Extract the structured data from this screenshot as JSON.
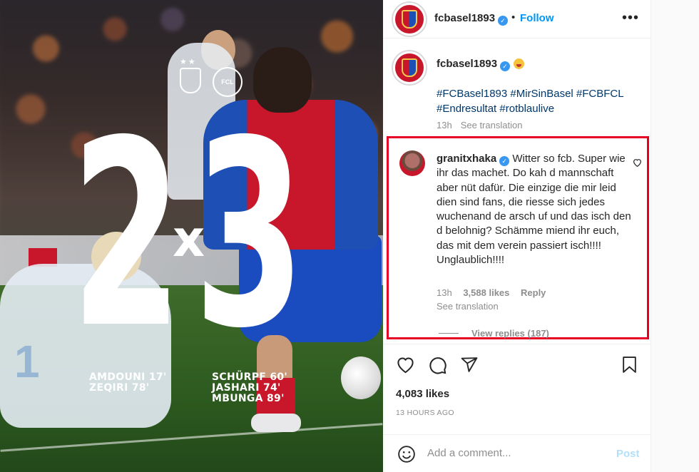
{
  "post_image": {
    "score_home": "2",
    "score_separator": "x",
    "score_away": "3",
    "scorers_home": [
      "AMDOUNI 17'",
      "ZEQIRI 78'"
    ],
    "scorers_away": [
      "SCHÜRPF 60'",
      "JASHARI 74'",
      "MBUNGA 89'"
    ],
    "crest_right_text": "FCL",
    "crest_left_stars": "★★",
    "player_number": "1"
  },
  "header": {
    "username": "fcbasel1893",
    "separator": "•",
    "follow_label": "Follow",
    "more_label": "•••"
  },
  "caption": {
    "username": "fcbasel1893",
    "hashtags": "#FCBasel1893 #MirSinBasel #FCBFCL #Endresultat #rotblaulive",
    "time": "13h",
    "see_translation": "See translation"
  },
  "comment": {
    "username": "granitxhaka",
    "text": "Witter so fcb. Super wie ihr das machet. Do kah d mannschaft aber nüt dafür. Die einzige die mir leid dien sind fans, die riesse sich jedes wuchenand de arsch uf und das isch den d belohnig? Schämme miend ihr euch, das mit dem verein passiert isch!!!! Unglaublich!!!!",
    "time": "13h",
    "likes": "3,588 likes",
    "reply_label": "Reply",
    "see_translation": "See translation",
    "view_replies": "View replies (187)"
  },
  "post_footer": {
    "likes": "4,083 likes",
    "timestamp": "13 HOURS AGO"
  },
  "add_comment": {
    "placeholder": "Add a comment...",
    "post_label": "Post"
  },
  "colors": {
    "accent_blue": "#0095f6",
    "highlight_red": "#e60023",
    "club_red": "#c8172b",
    "club_blue": "#1d4fb5"
  },
  "icons": [
    "verified-badge-icon",
    "more-options-icon",
    "heart-icon",
    "comment-icon",
    "share-icon",
    "bookmark-icon",
    "emoji-icon"
  ]
}
